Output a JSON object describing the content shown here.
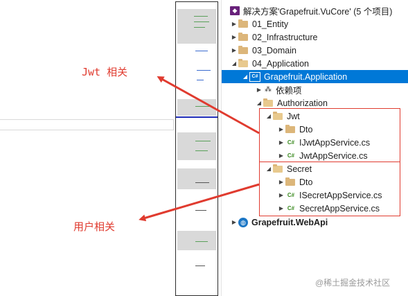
{
  "annotations": {
    "jwt_label": "Jwt 相关",
    "user_label": "用户相关",
    "color": "#e03b2f"
  },
  "solution_explorer": {
    "solution": "解决方案'Grapefruit.VuCore' (5 个项目)",
    "folders": {
      "entity": "01_Entity",
      "infrastructure": "02_Infrastructure",
      "domain": "03_Domain",
      "application": "04_Application"
    },
    "application_project": "Grapefruit.Application",
    "dependencies": "依赖项",
    "authorization": "Authorization",
    "jwt_folder": "Jwt",
    "jwt_dto": "Dto",
    "ijwt_service": "IJwtAppService.cs",
    "jwt_service": "JwtAppService.cs",
    "secret_folder": "Secret",
    "secret_dto": "Dto",
    "isecret_service": "ISecretAppService.cs",
    "secret_service": "SecretAppService.cs",
    "webapi_project": "Grapefruit.WebApi",
    "selection_color": "#0078d7"
  },
  "icons": {
    "cs": "C#",
    "project": "C#"
  },
  "watermark": "@稀土掘金技术社区"
}
